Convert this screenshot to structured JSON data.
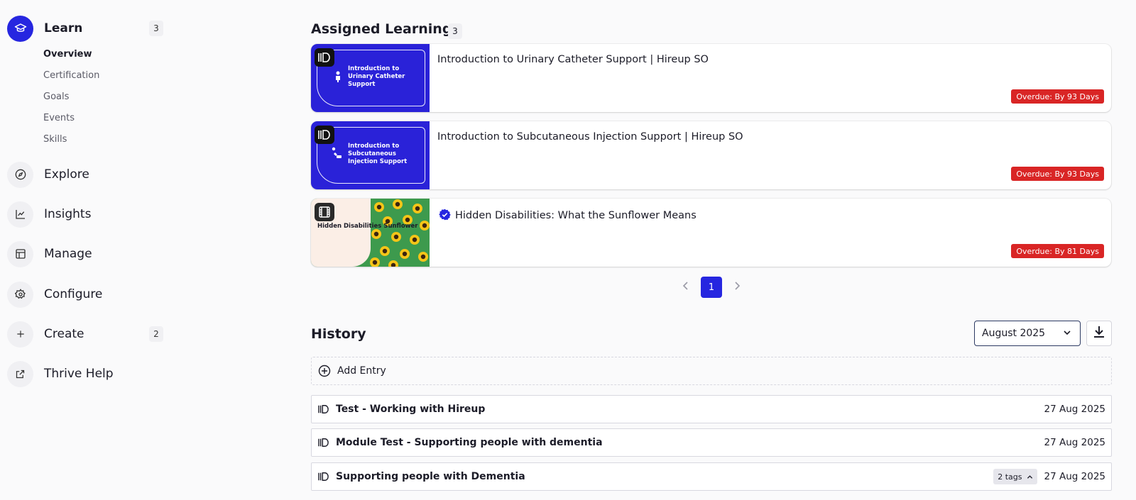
{
  "sidebar": {
    "learn": {
      "label": "Learn",
      "count": "3"
    },
    "sub_items": [
      "Overview",
      "Certification",
      "Goals",
      "Events",
      "Skills"
    ],
    "explore": "Explore",
    "insights": "Insights",
    "manage": "Manage",
    "configure": "Configure",
    "create": {
      "label": "Create",
      "count": "2"
    },
    "thrive_help": "Thrive Help"
  },
  "assigned": {
    "title": "Assigned Learning",
    "count": "3",
    "cards": [
      {
        "thumb_text": "Introduction to Urinary Catheter Support",
        "title": "Introduction to Urinary Catheter Support | Hireup SO",
        "status": "Overdue: By 93 Days"
      },
      {
        "thumb_text": "Introduction to Subcutaneous Injection Support",
        "title": "Introduction to Subcutaneous Injection Support | Hireup SO",
        "status": "Overdue: By 93 Days"
      },
      {
        "thumb_text": "Hidden Disabilities Sunflower",
        "title": "Hidden Disabilities: What the Sunflower Means",
        "status": "Overdue: By 81 Days"
      }
    ],
    "pagination": {
      "current_page": "1"
    }
  },
  "history": {
    "title": "History",
    "month_select": "August 2025",
    "add_entry": "Add Entry",
    "rows": [
      {
        "title": "Test - Working with Hireup",
        "date": "27 Aug 2025"
      },
      {
        "title": "Module Test - Supporting people with dementia",
        "date": "27 Aug 2025"
      },
      {
        "title": "Supporting people with Dementia",
        "tags": "2 tags",
        "date": "27 Aug 2025"
      }
    ]
  },
  "colors": {
    "accent": "#2626e0",
    "overdue": "#d92525",
    "thumb_blue": "#2a22d8"
  },
  "icons": {
    "learn": "graduation-cap-icon",
    "explore": "compass-icon",
    "insights": "line-chart-icon",
    "manage": "layout-icon",
    "configure": "gear-icon",
    "create": "plus-icon",
    "thrive_help": "external-link-icon"
  }
}
